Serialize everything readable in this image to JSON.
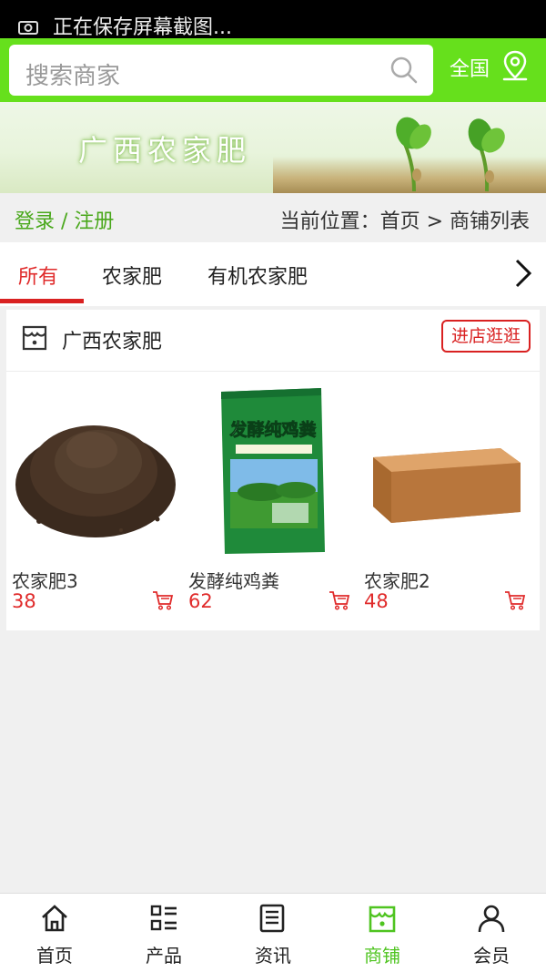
{
  "status_bar": {
    "notice": "正在保存屏幕截图..."
  },
  "search": {
    "placeholder": "搜索商家",
    "region_label": "全国"
  },
  "banner": {
    "title": "广西农家肥"
  },
  "breadcrumb": {
    "login_label": "登录 / 注册",
    "path": "当前位置：首页 > 商铺列表"
  },
  "tabs": [
    {
      "label": "所有",
      "active": true
    },
    {
      "label": "农家肥",
      "active": false
    },
    {
      "label": "有机农家肥",
      "active": false
    }
  ],
  "shop": {
    "name": "广西农家肥",
    "visit_button": "进店逛逛",
    "products": [
      {
        "name": "农家肥3",
        "price": "38",
        "image": "soil-pile"
      },
      {
        "name": "发酵纯鸡粪",
        "price": "62",
        "image": "fertilizer-bag",
        "bag_text": "发酵纯鸡粪"
      },
      {
        "name": "农家肥2",
        "price": "48",
        "image": "coir-block"
      }
    ]
  },
  "bottom_nav": [
    {
      "label": "首页",
      "icon": "home-icon",
      "active": false
    },
    {
      "label": "产品",
      "icon": "grid-list-icon",
      "active": false
    },
    {
      "label": "资讯",
      "icon": "news-icon",
      "active": false
    },
    {
      "label": "商铺",
      "icon": "shop-icon",
      "active": true
    },
    {
      "label": "会员",
      "icon": "user-icon",
      "active": false
    }
  ],
  "colors": {
    "brand_green": "#66e01c",
    "accent_red": "#d92121",
    "active_nav": "#4fc420"
  }
}
